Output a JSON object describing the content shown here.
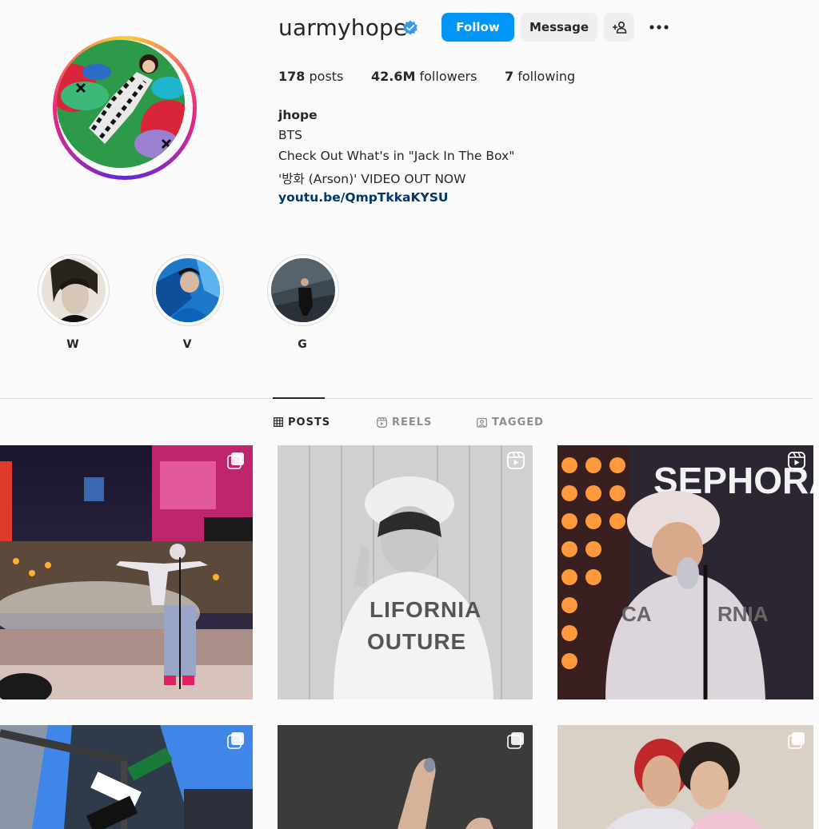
{
  "profile": {
    "username": "uarmyhope",
    "verified": true,
    "follow_label": "Follow",
    "message_label": "Message",
    "suggest_icon": "add-person-icon",
    "more_icon": "more-horizontal-icon"
  },
  "stats": {
    "posts_count": "178",
    "posts_label": "posts",
    "followers_count": "42.6M",
    "followers_label": "followers",
    "following_count": "7",
    "following_label": "following"
  },
  "bio": {
    "name": "jhope",
    "line1": "BTS",
    "line2": "Check Out What's in \"Jack In The Box\"",
    "line3": "'방화 (Arson)' VIDEO OUT NOW",
    "link": "youtu.be/QmpTkkaKYSU"
  },
  "highlights": [
    {
      "label": "W"
    },
    {
      "label": "V"
    },
    {
      "label": "G"
    }
  ],
  "tabs": [
    {
      "label": "POSTS",
      "icon": "grid-icon",
      "active": true
    },
    {
      "label": "REELS",
      "icon": "reels-icon",
      "active": false
    },
    {
      "label": "TAGGED",
      "icon": "tagged-icon",
      "active": false
    }
  ],
  "colors": {
    "accent": "#0095f6",
    "link": "#00376b",
    "verified": "#3897f0"
  }
}
